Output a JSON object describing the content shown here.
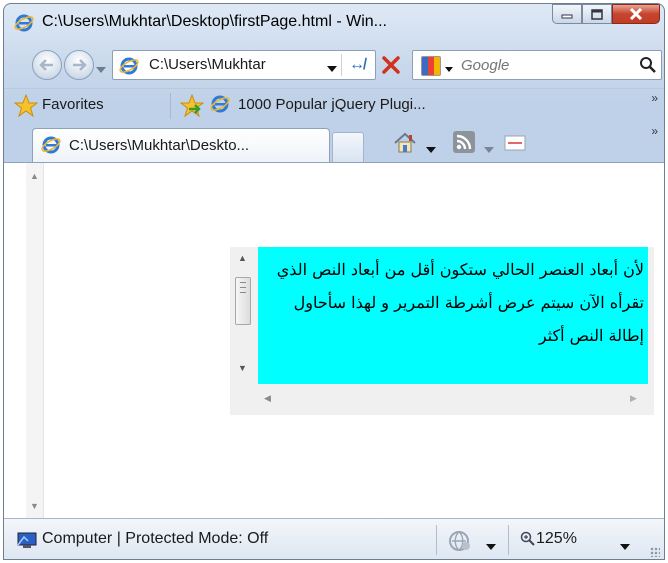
{
  "window": {
    "title": "C:\\Users\\Mukhtar\\Desktop\\firstPage.html - Win..."
  },
  "address_bar": {
    "url": "C:\\Users\\Mukhtar"
  },
  "search": {
    "placeholder": "Google"
  },
  "favorites_bar": {
    "favorites_label": "Favorites",
    "link_label": "1000 Popular jQuery Plugi..."
  },
  "tabs": [
    {
      "label": "C:\\Users\\Mukhtar\\Deskto..."
    }
  ],
  "content": {
    "scroll_box_text": "لأن أبعاد العنصر الحالي ستكون أقل من أبعاد النص الذي تقرأه الآن سيتم عرض أشرطة التمرير و لهذا سأحاول إطالة النص أكثر",
    "scroll_box_bg": "#00ffff"
  },
  "status_bar": {
    "zone_text": "Computer | Protected Mode: Off",
    "zoom": "125%"
  },
  "colors": {
    "chrome": "#c9d9ec",
    "close_button": "#c7442e"
  }
}
